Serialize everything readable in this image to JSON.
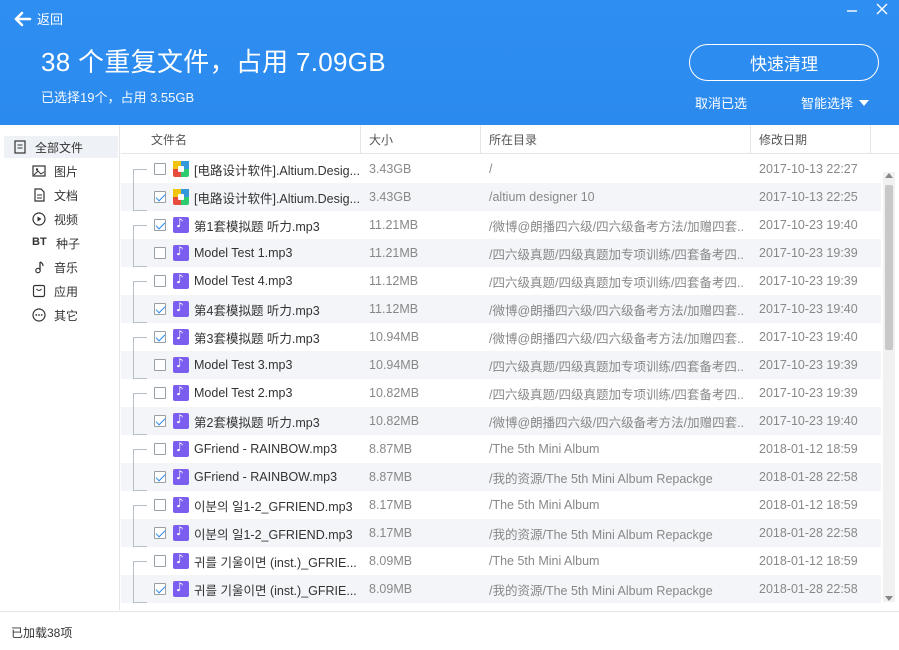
{
  "header": {
    "back_label": "返回",
    "title": "38 个重复文件，占用 7.09GB",
    "subtitle": "已选择19个，占用 3.55GB",
    "quick_clean_label": "快速清理",
    "cancel_selected_label": "取消已选",
    "smart_select_label": "智能选择"
  },
  "sidebar": {
    "items": [
      {
        "label": "全部文件",
        "icon": "all-files-icon"
      },
      {
        "label": "图片",
        "icon": "image-icon"
      },
      {
        "label": "文档",
        "icon": "document-icon"
      },
      {
        "label": "视频",
        "icon": "video-icon"
      },
      {
        "label": "种子",
        "icon": "bt-icon",
        "badge": "BT"
      },
      {
        "label": "音乐",
        "icon": "music-icon"
      },
      {
        "label": "应用",
        "icon": "app-icon"
      },
      {
        "label": "其它",
        "icon": "other-icon"
      }
    ]
  },
  "table": {
    "columns": [
      "文件名",
      "大小",
      "所在目录",
      "修改日期"
    ],
    "rows": [
      {
        "checked": false,
        "icon": "app",
        "name": "[电路设计软件].Altium.Desig...",
        "size": "3.43GB",
        "dir": "/",
        "date": "2017-10-13 22:27"
      },
      {
        "checked": true,
        "icon": "app",
        "name": "[电路设计软件].Altium.Desig...",
        "size": "3.43GB",
        "dir": "/altium designer 10",
        "date": "2017-10-13 22:25"
      },
      {
        "checked": true,
        "icon": "audio",
        "name": "第1套模拟题 听力.mp3",
        "size": "11.21MB",
        "dir": "/微博@朗播四六级/四六级备考方法/加赠四套...",
        "date": "2017-10-23 19:40"
      },
      {
        "checked": false,
        "icon": "audio",
        "name": "Model Test 1.mp3",
        "size": "11.21MB",
        "dir": "/四六级真题/四级真题加专项训练/四套备考四...",
        "date": "2017-10-23 19:39"
      },
      {
        "checked": false,
        "icon": "audio",
        "name": "Model Test 4.mp3",
        "size": "11.12MB",
        "dir": "/四六级真题/四级真题加专项训练/四套备考四...",
        "date": "2017-10-23 19:39"
      },
      {
        "checked": true,
        "icon": "audio",
        "name": "第4套模拟题 听力.mp3",
        "size": "11.12MB",
        "dir": "/微博@朗播四六级/四六级备考方法/加赠四套...",
        "date": "2017-10-23 19:40"
      },
      {
        "checked": true,
        "icon": "audio",
        "name": "第3套模拟题 听力.mp3",
        "size": "10.94MB",
        "dir": "/微博@朗播四六级/四六级备考方法/加赠四套...",
        "date": "2017-10-23 19:40"
      },
      {
        "checked": false,
        "icon": "audio",
        "name": "Model Test 3.mp3",
        "size": "10.94MB",
        "dir": "/四六级真题/四级真题加专项训练/四套备考四...",
        "date": "2017-10-23 19:39"
      },
      {
        "checked": false,
        "icon": "audio",
        "name": "Model Test 2.mp3",
        "size": "10.82MB",
        "dir": "/四六级真题/四级真题加专项训练/四套备考四...",
        "date": "2017-10-23 19:39"
      },
      {
        "checked": true,
        "icon": "audio",
        "name": "第2套模拟题 听力.mp3",
        "size": "10.82MB",
        "dir": "/微博@朗播四六级/四六级备考方法/加赠四套...",
        "date": "2017-10-23 19:40"
      },
      {
        "checked": false,
        "icon": "audio",
        "name": "GFriend - RAINBOW.mp3",
        "size": "8.87MB",
        "dir": "/The 5th Mini Album",
        "date": "2018-01-12 18:59"
      },
      {
        "checked": true,
        "icon": "audio",
        "name": "GFriend - RAINBOW.mp3",
        "size": "8.87MB",
        "dir": "/我的资源/The 5th Mini Album Repackge",
        "date": "2018-01-28 22:58"
      },
      {
        "checked": false,
        "icon": "audio",
        "name": "이분의 일1-2_GFRIEND.mp3",
        "size": "8.17MB",
        "dir": "/The 5th Mini Album",
        "date": "2018-01-12 18:59"
      },
      {
        "checked": true,
        "icon": "audio",
        "name": "이분의 일1-2_GFRIEND.mp3",
        "size": "8.17MB",
        "dir": "/我的资源/The 5th Mini Album Repackge",
        "date": "2018-01-28 22:58"
      },
      {
        "checked": false,
        "icon": "audio",
        "name": "귀를 기울이면 (inst.)_GFRIE...",
        "size": "8.09MB",
        "dir": "/The 5th Mini Album",
        "date": "2018-01-12 18:59"
      },
      {
        "checked": true,
        "icon": "audio",
        "name": "귀를 기울이면 (inst.)_GFRIE...",
        "size": "8.09MB",
        "dir": "/我的资源/The 5th Mini Album Repackge",
        "date": "2018-01-28 22:58"
      }
    ]
  },
  "status": {
    "loaded_label": "已加载38项"
  }
}
